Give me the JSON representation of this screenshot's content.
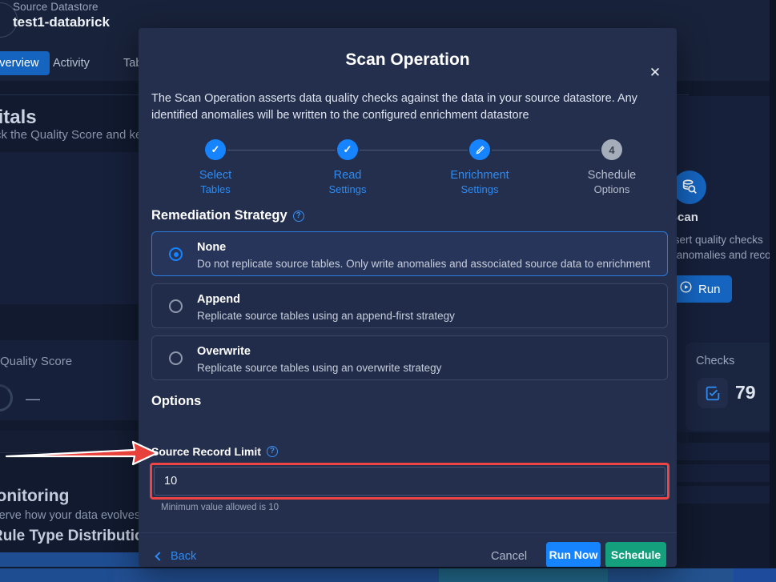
{
  "background": {
    "datastore_label": "Source Datastore",
    "datastore_name": "test1-databrick",
    "tabs": [
      {
        "label": "Overview",
        "active": true
      },
      {
        "label": "Activity",
        "active": false
      },
      {
        "label": "Tab",
        "active": false
      }
    ],
    "section_title": "Vitals",
    "section_subtitle": "Track the Quality Score and key metrics",
    "quality_score_label": "Quality Score",
    "quality_score_value": "—",
    "monitoring_title": "Monitoring",
    "monitoring_subtitle": "Observe how your data evolves over time",
    "rule_type_title": "Rule Type Distribution",
    "scan_card": {
      "icon": "database-search-icon",
      "title": "Scan",
      "desc_line1": "Assert quality checks",
      "desc_line2": "on anomalies and record",
      "run_label": "Run",
      "run_icon": "play-circle-icon"
    },
    "checks_card": {
      "title": "Checks",
      "icon": "check-square-icon",
      "value": "79"
    },
    "taskbar_segments": [
      "#1f4d91",
      "#224f93",
      "#23528f",
      "#1f6d8c",
      "#23538f",
      "#1e4b9b"
    ]
  },
  "modal": {
    "title": "Scan Operation",
    "close_icon": "close-icon",
    "description": "The Scan Operation asserts data quality checks against the data in your source datastore. Any identified anomalies will be written to the configured enrichment datastore",
    "stepper": {
      "steps": [
        {
          "badge": "✓",
          "state": "done",
          "line1": "Select",
          "line2": "Tables"
        },
        {
          "badge": "✓",
          "state": "done",
          "line1": "Read",
          "line2": "Settings"
        },
        {
          "badge": "✎",
          "state": "current",
          "line1": "Enrichment",
          "line2": "Settings"
        },
        {
          "badge": "4",
          "state": "todo",
          "line1": "Schedule",
          "line2": "Options"
        }
      ]
    },
    "remediation": {
      "heading": "Remediation Strategy",
      "help_icon": "help-circle-icon",
      "options": [
        {
          "label": "None",
          "desc": "Do not replicate source tables. Only write anomalies and associated source data to enrichment",
          "selected": true
        },
        {
          "label": "Append",
          "desc": "Replicate source tables using an append-first strategy",
          "selected": false
        },
        {
          "label": "Overwrite",
          "desc": "Replicate source tables using an overwrite strategy",
          "selected": false
        }
      ]
    },
    "options": {
      "heading": "Options",
      "source_record_limit": {
        "label": "Source Record Limit",
        "help_icon": "help-circle-icon",
        "value": "10",
        "placeholder": "",
        "hint": "Minimum value allowed is 10"
      }
    },
    "footer": {
      "back_label": "Back",
      "back_icon": "chevron-left-icon",
      "cancel_label": "Cancel",
      "run_now_label": "Run Now",
      "schedule_label": "Schedule"
    }
  },
  "annotation": {
    "arrow_icon": "red-arrow-right",
    "arrow_color": "#e8413c",
    "highlight_color": "#ef4444"
  }
}
